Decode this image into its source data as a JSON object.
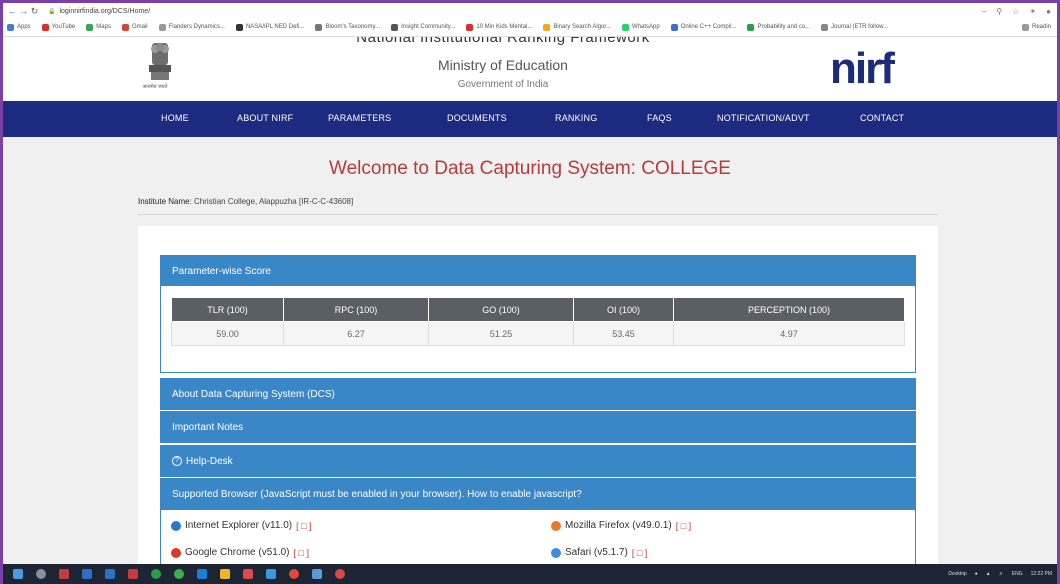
{
  "browser": {
    "url": "loginnirfindia.org/DCS/Home/",
    "bookmarks": [
      "Apps",
      "YouTube",
      "Maps",
      "Gmail",
      "Flanders Dynamics...",
      "NASA/IPL NED Defi...",
      "Bloom's Taxonomy...",
      "Insight Community...",
      "10 Min Kids Mental...",
      "Binary Search Algor...",
      "WhatsApp",
      "Online C++ Compil...",
      "Probability and co...",
      "Journal (ETR follow..."
    ],
    "reading_list": "Readin"
  },
  "header": {
    "title": "National Institutional Ranking Framework",
    "ministry": "Ministry of Education",
    "government": "Government of India",
    "emblem_caption": "सत्यमेव जयते",
    "logo_text": "nirf"
  },
  "nav": {
    "items": [
      {
        "label": "HOME"
      },
      {
        "label": "ABOUT NIRF"
      },
      {
        "label": "PARAMETERS"
      },
      {
        "label": "DOCUMENTS"
      },
      {
        "label": "RANKING"
      },
      {
        "label": "FAQS"
      },
      {
        "label": "NOTIFICATION/ADVT"
      },
      {
        "label": "CONTACT"
      }
    ]
  },
  "main": {
    "welcome": "Welcome to Data Capturing System: COLLEGE",
    "institute_label": "Institute Name",
    "institute_value": ": Christian College, Alappuzha [IR-C-C-43608]"
  },
  "score_panel": {
    "title": "Parameter-wise Score",
    "headers": [
      "TLR (100)",
      "RPC (100)",
      "GO (100)",
      "OI (100)",
      "PERCEPTION (100)"
    ],
    "values": [
      "59.00",
      "6.27",
      "51.25",
      "53.45",
      "4.97"
    ]
  },
  "panels": {
    "about": "About Data Capturing System (DCS)",
    "notes": "Important Notes",
    "helpdesk": "Help-Desk",
    "browser": "Supported Browser (JavaScript must be enabled in your browser). How to enable javascript?"
  },
  "browsers": {
    "ie": "Internet Explorer (v11.0)",
    "firefox": "Mozilla Firefox (v49.0.1)",
    "chrome": "Google Chrome (v51.0)",
    "safari": "Safari (v5.1.7)",
    "pdf_mark": "[ □ ]"
  },
  "taskbar": {
    "desktop": "Desktop",
    "lang": "ENG",
    "time": "12:22 PM"
  },
  "colors": {
    "nav": "#1c2b80",
    "panel": "#3a87c8",
    "welcome": "#b83b3b",
    "frame": "#7b3fa8"
  }
}
